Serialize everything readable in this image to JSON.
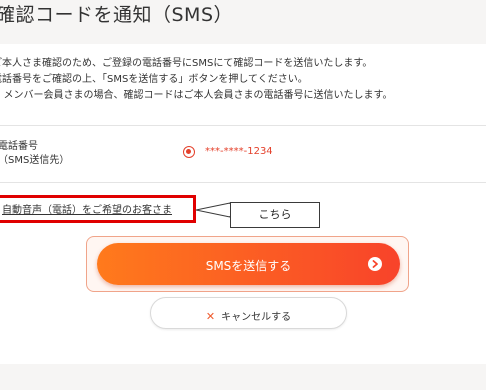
{
  "page": {
    "title": "確認コードを通知（SMS）"
  },
  "intro": {
    "lines": [
      "ご本人さま確認のため、ご登録の電話番号にSMSにて確認コードを送信いたします。",
      "電話番号をご確認の上、「SMSを送信する」ボタンを押してください。",
      "※ メンバー会員さまの場合、確認コードはご本人会員さまの電話番号に送信いたします。"
    ]
  },
  "phone": {
    "label_line1": "電話番号",
    "label_line2": "（SMS送信先）",
    "value": "***-****-1234"
  },
  "voice_option": {
    "link_text": "自動音声（電話）をご希望のお客さま"
  },
  "annotation": {
    "callout_text": "こちら",
    "highlight_color": "#e00000"
  },
  "actions": {
    "send_sms_label": "SMSを送信する",
    "cancel_label": "キャンセルする"
  },
  "colors": {
    "accent": "#f8432a",
    "accent_start": "#ff7a1c",
    "radio": "#e4412c"
  },
  "icons": {
    "sms_arrow": "chevron-right-circle-icon",
    "cancel": "close-icon",
    "radio": "radio-selected-icon"
  }
}
